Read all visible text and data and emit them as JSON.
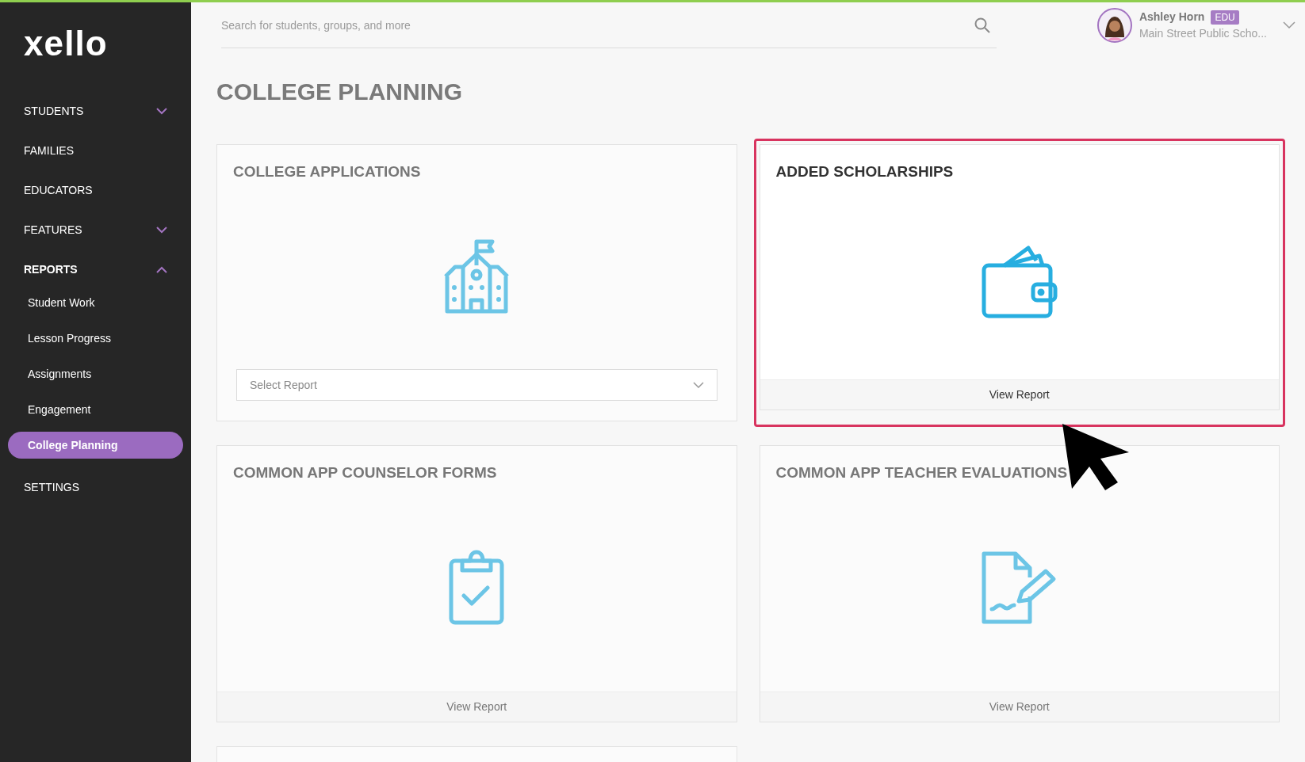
{
  "logo": "xello",
  "sidebar": {
    "items": [
      {
        "label": "STUDENTS",
        "kind": "group",
        "expanded": false,
        "selected": false
      },
      {
        "label": "FAMILIES",
        "kind": "link",
        "selected": false
      },
      {
        "label": "EDUCATORS",
        "kind": "link",
        "selected": false
      },
      {
        "label": "FEATURES",
        "kind": "group",
        "expanded": false,
        "selected": false
      },
      {
        "label": "REPORTS",
        "kind": "group",
        "expanded": true,
        "selected": true,
        "children": [
          {
            "label": "Student Work",
            "selected": false
          },
          {
            "label": "Lesson Progress",
            "selected": false
          },
          {
            "label": "Assignments",
            "selected": false
          },
          {
            "label": "Engagement",
            "selected": false
          },
          {
            "label": "College Planning",
            "selected": true
          }
        ]
      },
      {
        "label": "SETTINGS",
        "kind": "link",
        "selected": false
      }
    ]
  },
  "search": {
    "placeholder": "Search for students, groups, and more"
  },
  "user": {
    "name": "Ashley Horn",
    "badge": "EDU",
    "school": "Main Street Public Scho..."
  },
  "page_title": "COLLEGE PLANNING",
  "cards": [
    {
      "title": "COLLEGE APPLICATIONS",
      "footer": {
        "kind": "select",
        "label": "Select Report"
      },
      "highlighted": false
    },
    {
      "title": "ADDED SCHOLARSHIPS",
      "footer": {
        "kind": "link",
        "label": "View Report"
      },
      "highlighted": true
    },
    {
      "title": "COMMON APP COUNSELOR FORMS",
      "footer": {
        "kind": "link",
        "label": "View Report"
      },
      "highlighted": false
    },
    {
      "title": "COMMON APP TEACHER EVALUATIONS",
      "footer": {
        "kind": "link",
        "label": "View Report"
      },
      "highlighted": false
    }
  ]
}
